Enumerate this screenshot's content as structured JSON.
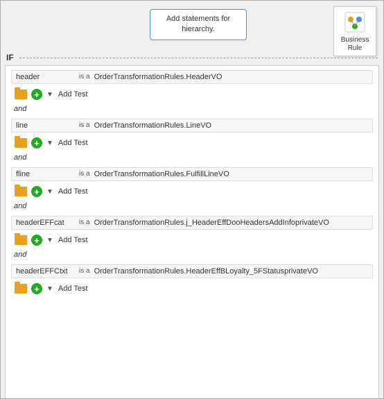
{
  "tooltip": {
    "text": "Add statements for hierarchy."
  },
  "business_rule": {
    "label": "Business\nRule"
  },
  "if_label": "IF",
  "conditions": [
    {
      "id": 1,
      "name": "header",
      "is_a": "is\na",
      "value": "OrderTransformationRules.HeaderVO"
    },
    {
      "id": 2,
      "name": "line",
      "is_a": "is\na",
      "value": "OrderTransformationRules.LineVO"
    },
    {
      "id": 3,
      "name": "fline",
      "is_a": "is\na",
      "value": "OrderTransformationRules.FulfillLineVO"
    },
    {
      "id": 4,
      "name": "headerEFFcat",
      "is_a": "is\na",
      "value": "OrderTransformationRules.j_HeaderEffDooHeadersAddInfoprivateVO"
    },
    {
      "id": 5,
      "name": "headerEFFCtxt",
      "is_a": "is\na",
      "value": "OrderTransformationRules.HeaderEffBLoyalty_5FStatusprivateVO"
    }
  ],
  "actions_row": {
    "add_test": "Add Test"
  },
  "and_label": "and"
}
